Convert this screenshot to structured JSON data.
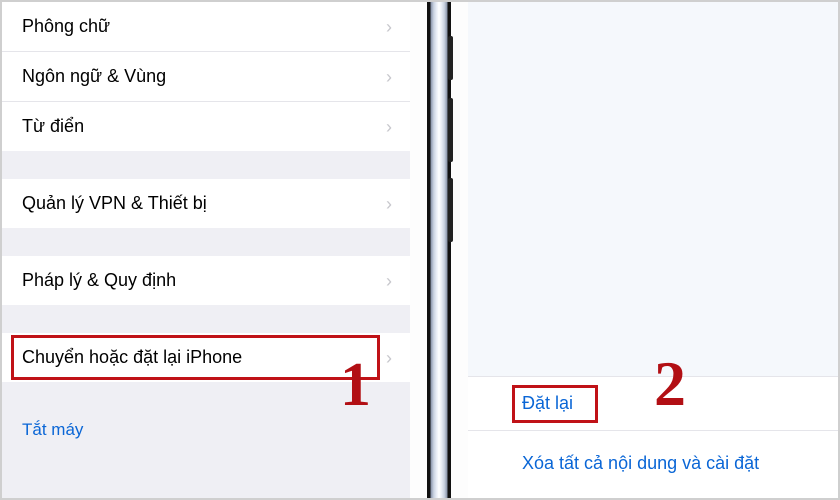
{
  "left": {
    "group1": [
      {
        "label": "Phông chữ"
      },
      {
        "label": "Ngôn ngữ & Vùng"
      },
      {
        "label": "Từ điển"
      }
    ],
    "group2": [
      {
        "label": "Quản lý VPN & Thiết bị"
      }
    ],
    "group3": [
      {
        "label": "Pháp lý & Quy định"
      }
    ],
    "group4": [
      {
        "label": "Chuyển hoặc đặt lại iPhone"
      }
    ],
    "shutdown": "Tắt máy"
  },
  "right": {
    "reset": "Đặt lại",
    "erase_all": "Xóa tất cả nội dung và cài đặt"
  },
  "annotations": {
    "step1": "1",
    "step2": "2"
  },
  "colors": {
    "highlight": "#c01217",
    "link": "#0a66d6"
  }
}
